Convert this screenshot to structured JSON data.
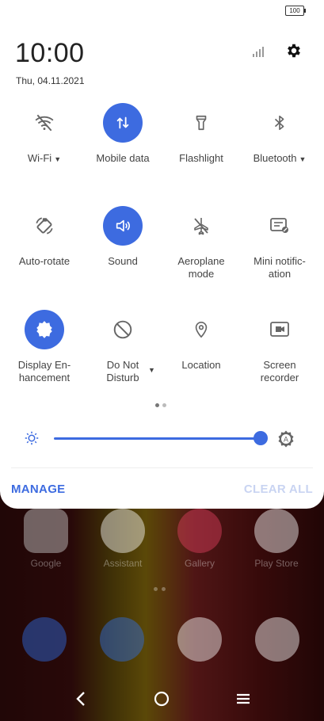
{
  "status_bar": {
    "battery": "100"
  },
  "header": {
    "time": "10:00",
    "date": "Thu, 04.11.2021"
  },
  "tiles": [
    {
      "label": "Wi-Fi",
      "icon": "wifi-off-icon",
      "active": false,
      "has_menu": true
    },
    {
      "label": "Mobile data",
      "icon": "mobile-data-icon",
      "active": true,
      "has_menu": false
    },
    {
      "label": "Flashlight",
      "icon": "flashlight-icon",
      "active": false,
      "has_menu": false
    },
    {
      "label": "Bluetooth",
      "icon": "bluetooth-icon",
      "active": false,
      "has_menu": true
    },
    {
      "label": "Auto-rotate",
      "icon": "auto-rotate-icon",
      "active": false
    },
    {
      "label": "Sound",
      "icon": "sound-icon",
      "active": true
    },
    {
      "label_line1": "Aeroplane",
      "label_line2": "mode",
      "icon": "aeroplane-icon",
      "active": false
    },
    {
      "label_line1": "Mini notific-",
      "label_line2": "ation",
      "icon": "mini-notification-icon",
      "active": false
    },
    {
      "label_line1": "Display En-",
      "label_line2": "hancement",
      "icon": "display-enhancement-icon",
      "active": true
    },
    {
      "label_line1": "Do Not",
      "label_line2": "Disturb",
      "icon": "do-not-disturb-icon",
      "active": false,
      "has_menu": true
    },
    {
      "label": "Location",
      "icon": "location-icon",
      "active": false
    },
    {
      "label_line1": "Screen",
      "label_line2": "recorder",
      "icon": "screen-recorder-icon",
      "active": false
    }
  ],
  "brightness": {
    "level": 0.99
  },
  "actions": {
    "manage": "MANAGE",
    "clear_all": "CLEAR ALL"
  },
  "home": {
    "apps": [
      "Google",
      "Assistant",
      "Gallery",
      "Play Store"
    ]
  },
  "colors": {
    "accent": "#3d6be0"
  }
}
